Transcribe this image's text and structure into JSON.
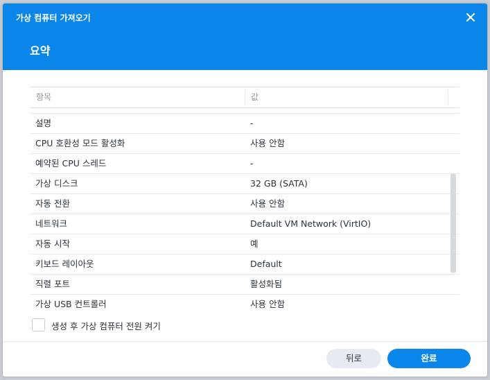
{
  "dialog": {
    "title": "가상 컴퓨터 가져오기",
    "step_title": "요약"
  },
  "table": {
    "headers": {
      "item": "항목",
      "value": "값"
    },
    "rows": [
      {
        "item": "설명",
        "value": "-"
      },
      {
        "item": "CPU 호환성 모드 활성화",
        "value": "사용 안함"
      },
      {
        "item": "예약된 CPU 스레드",
        "value": "-"
      },
      {
        "item": "가상 디스크",
        "value": "32 GB (SATA)"
      },
      {
        "item": "자동 전환",
        "value": "사용 안함"
      },
      {
        "item": "네트워크",
        "value": "Default VM Network (VirtIO)"
      },
      {
        "item": "자동 시작",
        "value": "예"
      },
      {
        "item": "키보드 레이아웃",
        "value": "Default"
      },
      {
        "item": "직렬 포트",
        "value": "활성화됨"
      },
      {
        "item": "가상 USB 컨트롤러",
        "value": "사용 안함"
      }
    ]
  },
  "checkbox": {
    "label": "생성 후 가상 컴퓨터 전원 켜기",
    "checked": false
  },
  "buttons": {
    "back": "뒤로",
    "finish": "완료"
  },
  "colors": {
    "accent": "#0a85ea"
  }
}
